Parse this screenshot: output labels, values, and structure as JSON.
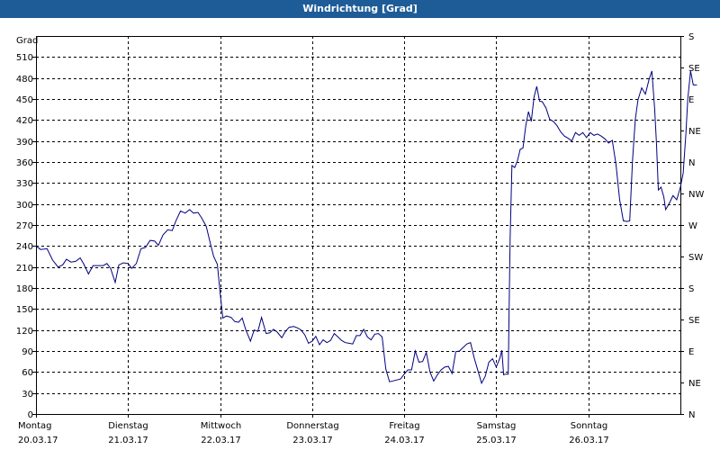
{
  "window": {
    "title": "Windrichtung [Grad]"
  },
  "chart_data": {
    "type": "line",
    "ylabel": "Grad",
    "ylim": [
      0,
      540
    ],
    "yticks": [
      0,
      30,
      60,
      90,
      120,
      150,
      180,
      210,
      240,
      270,
      300,
      330,
      360,
      390,
      420,
      450,
      480,
      510
    ],
    "right_axis_labels": [
      {
        "value": 0,
        "label": "N"
      },
      {
        "value": 45,
        "label": "NE"
      },
      {
        "value": 90,
        "label": "E"
      },
      {
        "value": 135,
        "label": "SE"
      },
      {
        "value": 180,
        "label": "S"
      },
      {
        "value": 225,
        "label": "SW"
      },
      {
        "value": 270,
        "label": "W"
      },
      {
        "value": 315,
        "label": "NW"
      },
      {
        "value": 360,
        "label": "N"
      },
      {
        "value": 405,
        "label": "NE"
      },
      {
        "value": 450,
        "label": "E"
      },
      {
        "value": 495,
        "label": "SE"
      },
      {
        "value": 540,
        "label": "S"
      }
    ],
    "xlim": [
      0,
      7
    ],
    "days": [
      {
        "day": "Montag",
        "date": "20.03.17"
      },
      {
        "day": "Dienstag",
        "date": "21.03.17"
      },
      {
        "day": "Mittwoch",
        "date": "22.03.17"
      },
      {
        "day": "Donnerstag",
        "date": "23.03.17"
      },
      {
        "day": "Freitag",
        "date": "24.03.17"
      },
      {
        "day": "Samstag",
        "date": "25.03.17"
      },
      {
        "day": "Sonntag",
        "date": "26.03.17"
      }
    ],
    "grid": true,
    "line_color": "#000080",
    "series": [
      {
        "points": [
          [
            0.0,
            240
          ],
          [
            0.05,
            235
          ],
          [
            0.12,
            236
          ],
          [
            0.18,
            220
          ],
          [
            0.24,
            210
          ],
          [
            0.29,
            213
          ],
          [
            0.33,
            221
          ],
          [
            0.38,
            217
          ],
          [
            0.43,
            218
          ],
          [
            0.48,
            223
          ],
          [
            0.52,
            214
          ],
          [
            0.57,
            200
          ],
          [
            0.62,
            212
          ],
          [
            0.67,
            212
          ],
          [
            0.73,
            212
          ],
          [
            0.77,
            215
          ],
          [
            0.81,
            208
          ],
          [
            0.86,
            188
          ],
          [
            0.9,
            213
          ],
          [
            0.95,
            216
          ],
          [
            1.0,
            215
          ],
          [
            1.04,
            208
          ],
          [
            1.09,
            215
          ],
          [
            1.14,
            236
          ],
          [
            1.19,
            238
          ],
          [
            1.24,
            248
          ],
          [
            1.29,
            247
          ],
          [
            1.33,
            241
          ],
          [
            1.38,
            256
          ],
          [
            1.43,
            263
          ],
          [
            1.48,
            262
          ],
          [
            1.52,
            276
          ],
          [
            1.57,
            290
          ],
          [
            1.62,
            287
          ],
          [
            1.67,
            292
          ],
          [
            1.71,
            287
          ],
          [
            1.76,
            288
          ],
          [
            1.8,
            280
          ],
          [
            1.85,
            268
          ],
          [
            1.89,
            246
          ],
          [
            1.93,
            225
          ],
          [
            1.97,
            214
          ],
          [
            2.0,
            173
          ],
          [
            2.03,
            137
          ],
          [
            2.07,
            140
          ],
          [
            2.12,
            138
          ],
          [
            2.16,
            132
          ],
          [
            2.2,
            131
          ],
          [
            2.24,
            137
          ],
          [
            2.28,
            120
          ],
          [
            2.33,
            104
          ],
          [
            2.37,
            120
          ],
          [
            2.41,
            118
          ],
          [
            2.45,
            138
          ],
          [
            2.5,
            115
          ],
          [
            2.54,
            116
          ],
          [
            2.58,
            121
          ],
          [
            2.62,
            117
          ],
          [
            2.67,
            109
          ],
          [
            2.71,
            118
          ],
          [
            2.75,
            124
          ],
          [
            2.8,
            125
          ],
          [
            2.84,
            123
          ],
          [
            2.88,
            120
          ],
          [
            2.92,
            113
          ],
          [
            2.96,
            101
          ],
          [
            3.0,
            104
          ],
          [
            3.04,
            111
          ],
          [
            3.08,
            99
          ],
          [
            3.12,
            106
          ],
          [
            3.16,
            102
          ],
          [
            3.2,
            105
          ],
          [
            3.24,
            115
          ],
          [
            3.28,
            110
          ],
          [
            3.32,
            105
          ],
          [
            3.36,
            102
          ],
          [
            3.4,
            101
          ],
          [
            3.44,
            100
          ],
          [
            3.48,
            112
          ],
          [
            3.52,
            112
          ],
          [
            3.56,
            121
          ],
          [
            3.6,
            110
          ],
          [
            3.64,
            106
          ],
          [
            3.68,
            114
          ],
          [
            3.72,
            115
          ],
          [
            3.76,
            110
          ],
          [
            3.8,
            64
          ],
          [
            3.84,
            46
          ],
          [
            3.9,
            48
          ],
          [
            3.96,
            50
          ],
          [
            4.0,
            57
          ],
          [
            4.04,
            63
          ],
          [
            4.08,
            63
          ],
          [
            4.12,
            90
          ],
          [
            4.16,
            74
          ],
          [
            4.2,
            75
          ],
          [
            4.24,
            88
          ],
          [
            4.28,
            60
          ],
          [
            4.32,
            47
          ],
          [
            4.36,
            56
          ],
          [
            4.4,
            63
          ],
          [
            4.44,
            67
          ],
          [
            4.48,
            68
          ],
          [
            4.52,
            58
          ],
          [
            4.56,
            89
          ],
          [
            4.6,
            90
          ],
          [
            4.64,
            95
          ],
          [
            4.68,
            100
          ],
          [
            4.72,
            102
          ],
          [
            4.76,
            80
          ],
          [
            4.8,
            62
          ],
          [
            4.84,
            44
          ],
          [
            4.88,
            54
          ],
          [
            4.92,
            74
          ],
          [
            4.96,
            79
          ],
          [
            5.0,
            67
          ],
          [
            5.04,
            80
          ],
          [
            5.06,
            91
          ],
          [
            5.08,
            56
          ],
          [
            5.1,
            57
          ],
          [
            5.13,
            57
          ],
          [
            5.15,
            250
          ],
          [
            5.17,
            355
          ],
          [
            5.2,
            352
          ],
          [
            5.23,
            362
          ],
          [
            5.26,
            378
          ],
          [
            5.29,
            380
          ],
          [
            5.32,
            412
          ],
          [
            5.35,
            432
          ],
          [
            5.38,
            418
          ],
          [
            5.41,
            453
          ],
          [
            5.44,
            468
          ],
          [
            5.47,
            447
          ],
          [
            5.5,
            446
          ],
          [
            5.54,
            437
          ],
          [
            5.58,
            421
          ],
          [
            5.62,
            418
          ],
          [
            5.66,
            412
          ],
          [
            5.7,
            403
          ],
          [
            5.74,
            397
          ],
          [
            5.78,
            394
          ],
          [
            5.82,
            390
          ],
          [
            5.86,
            402
          ],
          [
            5.9,
            398
          ],
          [
            5.94,
            402
          ],
          [
            5.98,
            395
          ],
          [
            6.02,
            402
          ],
          [
            6.06,
            398
          ],
          [
            6.1,
            400
          ],
          [
            6.14,
            397
          ],
          [
            6.18,
            393
          ],
          [
            6.22,
            387
          ],
          [
            6.26,
            391
          ],
          [
            6.3,
            357
          ],
          [
            6.34,
            306
          ],
          [
            6.38,
            276
          ],
          [
            6.42,
            275
          ],
          [
            6.45,
            276
          ],
          [
            6.48,
            362
          ],
          [
            6.51,
            421
          ],
          [
            6.54,
            449
          ],
          [
            6.58,
            466
          ],
          [
            6.62,
            457
          ],
          [
            6.66,
            478
          ],
          [
            6.69,
            490
          ],
          [
            6.72,
            436
          ],
          [
            6.74,
            387
          ],
          [
            6.76,
            320
          ],
          [
            6.79,
            324
          ],
          [
            6.82,
            310
          ],
          [
            6.84,
            292
          ],
          [
            6.88,
            301
          ],
          [
            6.92,
            312
          ],
          [
            6.96,
            306
          ],
          [
            7.0,
            324
          ],
          [
            7.03,
            344
          ],
          [
            7.06,
            400
          ],
          [
            7.08,
            450
          ],
          [
            7.11,
            490
          ],
          [
            7.14,
            470
          ],
          [
            7.18,
            470
          ]
        ]
      }
    ]
  }
}
